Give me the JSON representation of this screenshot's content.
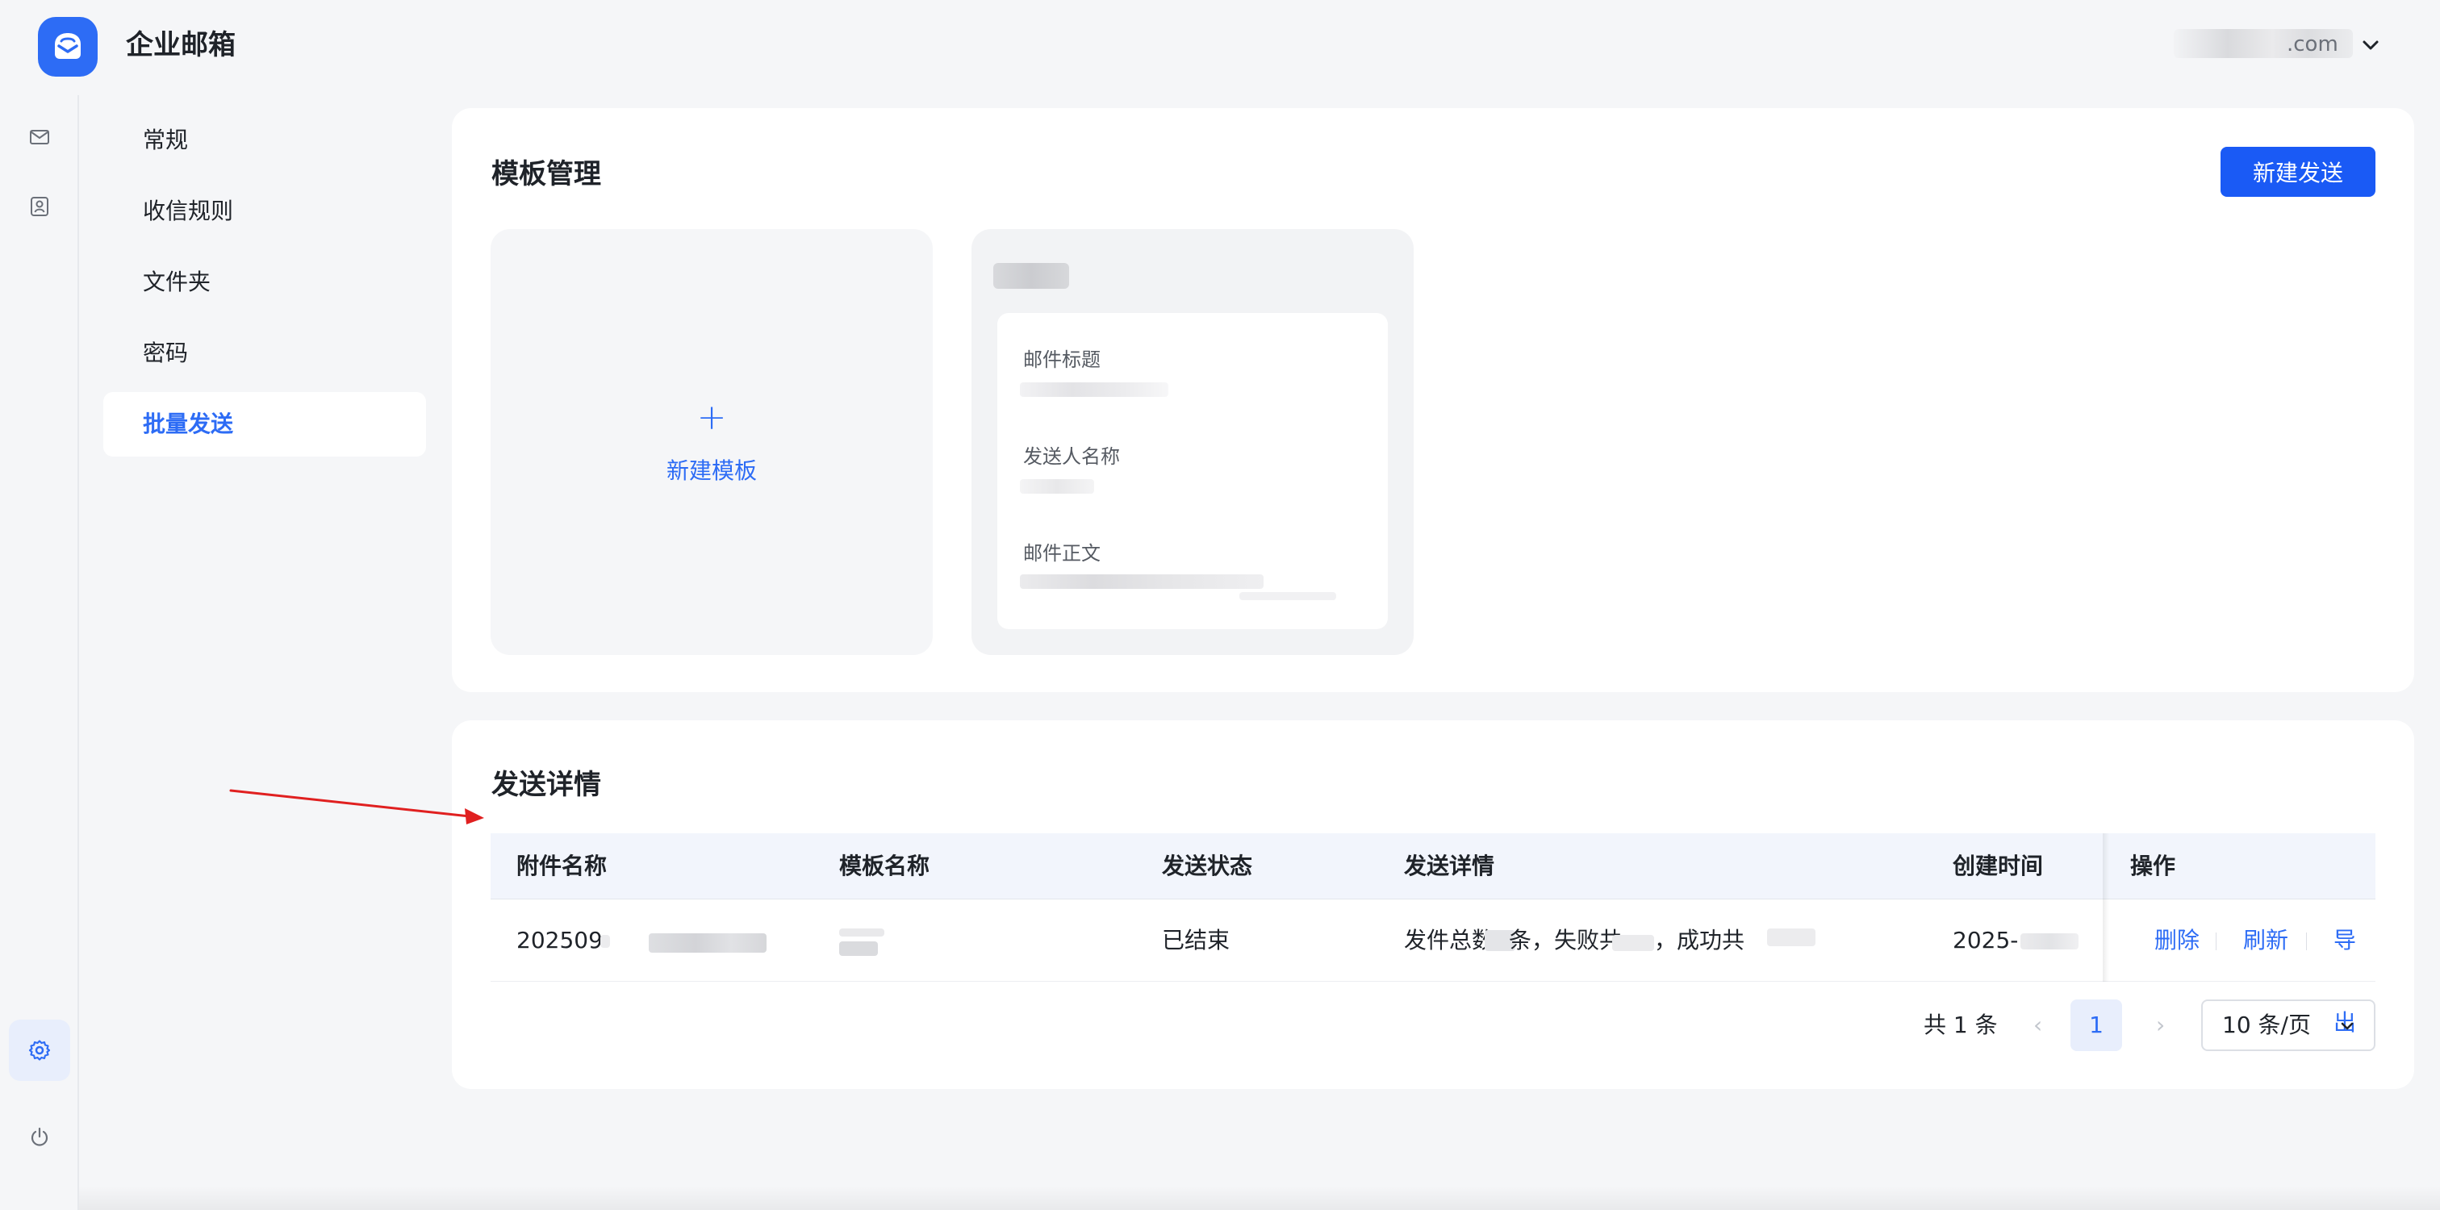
{
  "app": {
    "title": "企业邮箱",
    "user_partial": ".com"
  },
  "rail": {
    "items": [
      {
        "name": "mail-icon"
      },
      {
        "name": "contacts-icon"
      },
      {
        "name": "settings-icon",
        "active": true
      },
      {
        "name": "power-icon"
      }
    ]
  },
  "subnav": {
    "items": [
      {
        "label": "常规"
      },
      {
        "label": "收信规则"
      },
      {
        "label": "文件夹"
      },
      {
        "label": "密码"
      },
      {
        "label": "批量发送",
        "active": true
      }
    ]
  },
  "templates": {
    "title": "模板管理",
    "new_send_button": "新建发送",
    "new_template": {
      "plus": "+",
      "label": "新建模板"
    },
    "template_card": {
      "subject_label": "邮件标题",
      "sender_label": "发送人名称",
      "body_label": "邮件正文"
    }
  },
  "details": {
    "title": "发送详情",
    "columns": [
      "附件名称",
      "模板名称",
      "发送状态",
      "发送详情",
      "创建时间",
      "操作"
    ],
    "rows": [
      {
        "attachment": "202509",
        "template": "",
        "status": "已结束",
        "detail_parts": [
          "发件总数",
          "条，失败共",
          "，成功共"
        ],
        "created": "2025-",
        "actions": [
          "删除",
          "刷新",
          "导出"
        ]
      }
    ],
    "pagination": {
      "total": "共 1 条",
      "prev": "‹",
      "current": "1",
      "next": "›",
      "page_size": "10 条/页"
    }
  },
  "colors": {
    "accent": "#2d6cf5",
    "primary_button": "#1a5af5",
    "annotation_arrow": "#e02020"
  }
}
